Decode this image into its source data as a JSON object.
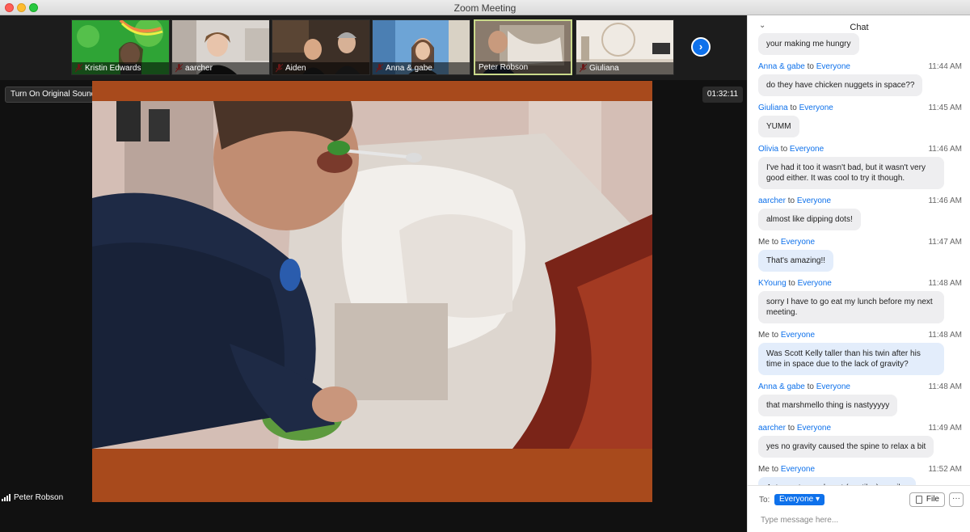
{
  "window": {
    "title": "Zoom Meeting"
  },
  "participants": [
    {
      "name": "Kristin Edwards",
      "muted": true,
      "active": false
    },
    {
      "name": "aarcher",
      "muted": true,
      "active": false
    },
    {
      "name": "Aiden",
      "muted": true,
      "active": false
    },
    {
      "name": "Anna & gabe",
      "muted": true,
      "active": false
    },
    {
      "name": "Peter Robson",
      "muted": false,
      "active": true
    },
    {
      "name": "Giuliana",
      "muted": true,
      "active": false
    }
  ],
  "controls": {
    "original_sound": "Turn On Original Sound",
    "timer": "01:32:11",
    "next_icon": "chevron-right-icon"
  },
  "speaker": {
    "name": "Peter Robson"
  },
  "chat": {
    "title": "Chat",
    "messages": [
      {
        "sender": "",
        "to": "",
        "recipient": "",
        "time": "",
        "text": "your making me hungry",
        "me": false
      },
      {
        "sender": "Anna & gabe",
        "to": "to",
        "recipient": "Everyone",
        "time": "11:44 AM",
        "text": "do they have chicken nuggets in space??",
        "me": false
      },
      {
        "sender": "Giuliana",
        "to": "to",
        "recipient": "Everyone",
        "time": "11:45 AM",
        "text": "YUMM",
        "me": false
      },
      {
        "sender": "Olivia",
        "to": "to",
        "recipient": "Everyone",
        "time": "11:46 AM",
        "text": "I've had it too it wasn't bad, but it wasn't very good either. It was cool to try it though.",
        "me": false
      },
      {
        "sender": "aarcher",
        "to": "to",
        "recipient": "Everyone",
        "time": "11:46 AM",
        "text": "almost like dipping dots!",
        "me": false
      },
      {
        "sender": "Me",
        "to": "to",
        "recipient": "Everyone",
        "time": "11:47 AM",
        "text": "That's amazing!!",
        "me": true
      },
      {
        "sender": "KYoung",
        "to": "to",
        "recipient": "Everyone",
        "time": "11:48 AM",
        "text": "sorry I have to go eat my lunch before my next meeting.",
        "me": false
      },
      {
        "sender": "Me",
        "to": "to",
        "recipient": "Everyone",
        "time": "11:48 AM",
        "text": "Was Scott Kelly taller than his twin after his time in space due to the lack of gravity?",
        "me": true
      },
      {
        "sender": "Anna & gabe",
        "to": "to",
        "recipient": "Everyone",
        "time": "11:48 AM",
        "text": "that marshmello thing is nastyyyyy",
        "me": false
      },
      {
        "sender": "aarcher",
        "to": "to",
        "recipient": "Everyone",
        "time": "11:49 AM",
        "text": "yes no gravity caused the spine to relax a bit",
        "me": false
      },
      {
        "sender": "Me",
        "to": "to",
        "recipient": "Everyone",
        "time": "11:52 AM",
        "text": "Astro = star, and naut (nautilus) = sailor",
        "me": true
      }
    ],
    "footer": {
      "to_label": "To:",
      "recipient": "Everyone ▾",
      "file_label": "File",
      "more_label": "···",
      "placeholder": "Type message here..."
    }
  }
}
